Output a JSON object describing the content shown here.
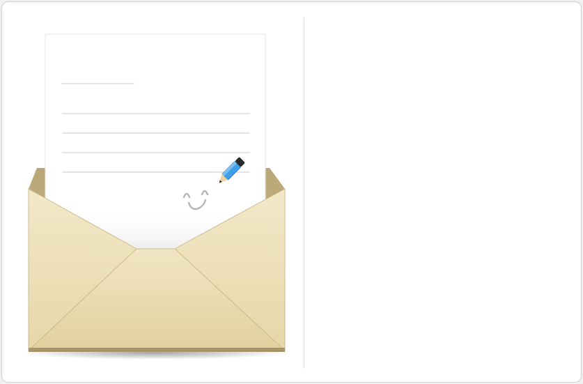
{
  "illustration": {
    "subject": "open-envelope-with-letter",
    "icons": [
      "envelope-icon",
      "letter-icon",
      "pencil-icon",
      "smiley-icon"
    ],
    "colors": {
      "envelope": "#ece0b8",
      "envelope_shadow": "#c9b78a",
      "paper": "#ffffff",
      "paper_lines": "#d4d4d4",
      "pencil_body": "#3f9fe8",
      "pencil_tip": "#2b2b2b",
      "smiley": "#b5b5b5"
    }
  }
}
